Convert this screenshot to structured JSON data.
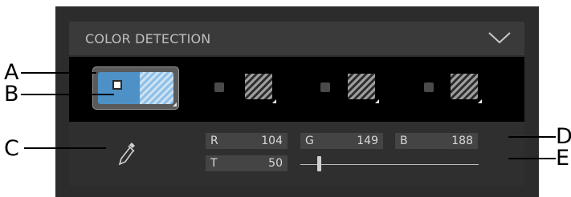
{
  "panel": {
    "title": "COLOR DETECTION"
  },
  "swatch_row": {
    "active_swatch": {
      "solid_color": "#4d91c6",
      "hatch_color": "#9cc8ec"
    }
  },
  "fields": {
    "r": {
      "label": "R",
      "value": "104"
    },
    "g": {
      "label": "G",
      "value": "149"
    },
    "b": {
      "label": "B",
      "value": "188"
    },
    "t": {
      "label": "T",
      "value": "50"
    }
  },
  "callouts": {
    "a": "A",
    "b": "B",
    "c": "C",
    "d": "D",
    "e": "E"
  },
  "icons": {
    "collapse": "chevron-down-icon",
    "picker": "eyedropper-icon",
    "pattern": "hatch-pattern-icon"
  }
}
